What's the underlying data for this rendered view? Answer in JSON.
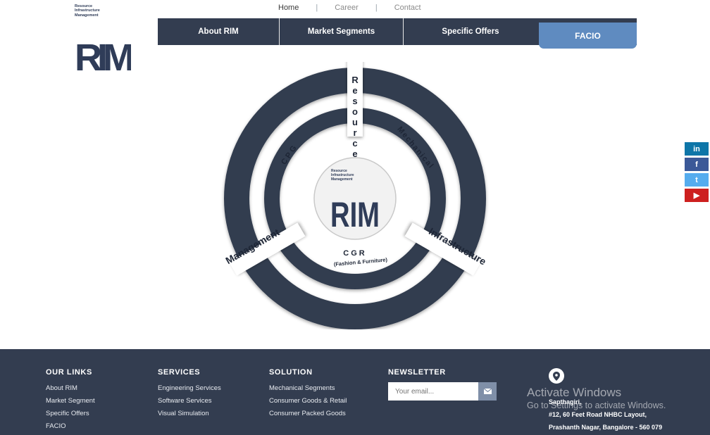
{
  "logo": {
    "tagline": [
      "Resource",
      "Infrastructure",
      "Management"
    ],
    "mark": "RIM"
  },
  "top_links": [
    {
      "label": "Home",
      "active": true
    },
    {
      "label": "Career",
      "active": false
    },
    {
      "label": "Contact",
      "active": false
    }
  ],
  "top_links_separator": "|",
  "nav": {
    "items": [
      "About RIM",
      "Market Segments",
      "Specific Offers"
    ],
    "highlight": "FACIO"
  },
  "diagram": {
    "outer_labels": {
      "top": "Resource",
      "right": "Infrastructure",
      "left": "Management"
    },
    "inner_labels": {
      "top_left": "CPG",
      "top_right": "Mechanical",
      "bottom": "CGR",
      "bottom_sub": "(Fashion & Furniture)"
    },
    "center_tagline": [
      "Resource",
      "Infrastructure",
      "Management"
    ],
    "center_mark": "RIM"
  },
  "social": [
    {
      "icon": "linkedin-icon",
      "glyph": "in",
      "color": "#0e76a8"
    },
    {
      "icon": "facebook-icon",
      "glyph": "f",
      "color": "#3b5998"
    },
    {
      "icon": "twitter-icon",
      "glyph": "t",
      "color": "#55acee"
    },
    {
      "icon": "youtube-icon",
      "glyph": "▶",
      "color": "#cd201f"
    }
  ],
  "footer": {
    "our_links": {
      "title": "OUR LINKS",
      "items": [
        "About RIM",
        "Market Segment",
        "Specific Offers",
        "FACIO"
      ]
    },
    "services": {
      "title": "SERVICES",
      "items": [
        "Engineering Services",
        "Software Services",
        "Visual Simulation"
      ]
    },
    "solution": {
      "title": "SOLUTION",
      "items": [
        "Mechanical Segments",
        "Consumer Goods & Retail",
        "Consumer Packed Goods"
      ]
    },
    "newsletter": {
      "title": "NEWSLETTER",
      "placeholder": "Your email..."
    },
    "address": [
      "Sapthagiri,",
      "#12, 60 Feet Road NHBC Layout,",
      "Prashanth Nagar, Bangalore - 560 079"
    ]
  },
  "watermark": {
    "title": "Activate Windows",
    "subtitle": "Go to Settings to activate Windows."
  },
  "colors": {
    "navy": "#333d50",
    "accent": "#5f8bc0",
    "white": "#ffffff"
  }
}
